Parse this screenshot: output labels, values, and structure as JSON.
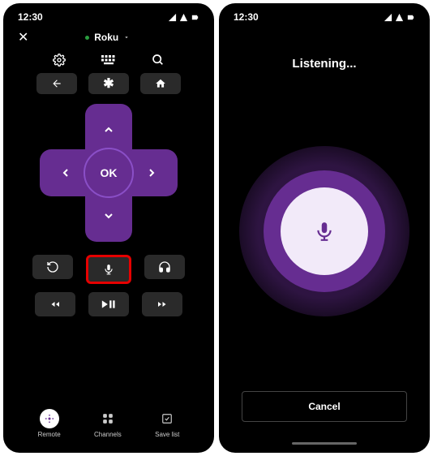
{
  "status": {
    "time": "12:30"
  },
  "left": {
    "device_name": "Roku",
    "icons": {
      "settings": "gear",
      "keyboard": "keyboard",
      "search": "search"
    },
    "pills": {
      "back": "back-arrow",
      "options": "asterisk",
      "home": "home"
    },
    "dpad": {
      "ok_label": "OK"
    },
    "ctrl": {
      "replay": "replay",
      "mic": "microphone",
      "headphones": "headphones"
    },
    "media": {
      "rew": "rewind",
      "playpause": "play-pause",
      "ff": "fast-forward"
    },
    "nav": {
      "remote": "Remote",
      "channels": "Channels",
      "savelist": "Save list"
    }
  },
  "right": {
    "title": "Listening...",
    "cancel_label": "Cancel"
  }
}
